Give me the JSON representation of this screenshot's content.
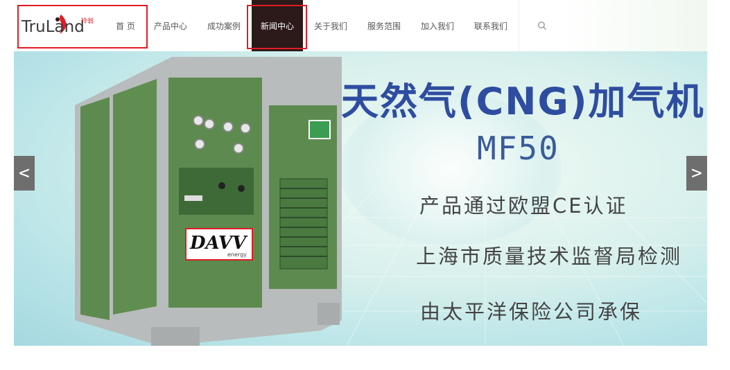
{
  "header": {
    "logo_text": "TruLand",
    "logo_small": "玲翁",
    "search_icon": "search-icon"
  },
  "nav": {
    "items": [
      {
        "label": "首 页"
      },
      {
        "label": "产品中心"
      },
      {
        "label": "成功案例"
      },
      {
        "label": "新闻中心",
        "active": true
      },
      {
        "label": "关于我们"
      },
      {
        "label": "服务范围"
      },
      {
        "label": "加入我们"
      },
      {
        "label": "联系我们"
      }
    ]
  },
  "banner": {
    "title": "天然气(CNG)加气机",
    "model": "MF50",
    "line1": "产品通过欧盟CE认证",
    "line2": "上海市质量技术监督局检测",
    "line3": "由太平洋保险公司承保",
    "brand": "DAVV",
    "brand_sub": "energy",
    "prev": "<",
    "next": ">"
  },
  "colors": {
    "highlight": "#e21b24",
    "nav_active_bg": "#2b1a19",
    "title_blue": "#2e4da0",
    "machine_green": "#5d8a4e",
    "frame_gray": "#b8bcbc"
  }
}
